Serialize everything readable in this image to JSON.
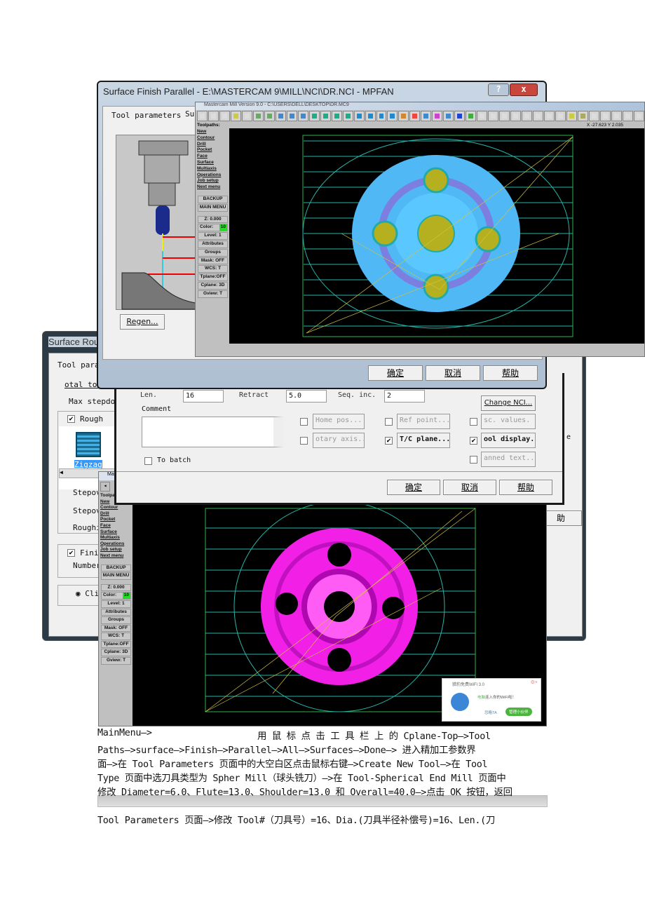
{
  "rough_window": {
    "title": "Surface Rou",
    "tab": "Tool param",
    "total_tol": "otal tol",
    "max_stepdown": "Max stepdow",
    "rough_label": "Rough",
    "zigzag": "Zigzag",
    "stepover1": "Stepov",
    "stepover2": "Stepov",
    "roughing": "Roughi",
    "finish_label": "Fini",
    "number": "Number",
    "climb": "Cli",
    "help_partial": "助",
    "side_e": "e"
  },
  "tool_dialog": {
    "len_label": "Len.",
    "len_value": "16",
    "retract_label": "Retract",
    "retract_value": "5.0",
    "seq_label": "Seq. inc.",
    "seq_value": "2",
    "comment_label": "Comment",
    "change_nci": "Change NCI...",
    "home_pos": "Home pos...",
    "ref_point": "Ref point...",
    "misc_values": "sc. values.",
    "rotary_axis": "otary axis..",
    "tc_plane": "T/C plane...",
    "tool_display": "ool display..",
    "canned_text": "anned text..",
    "to_batch": "To batch",
    "ok": "确定",
    "cancel": "取消",
    "help": "帮助",
    "checks": {
      "home_pos": false,
      "ref_point": false,
      "misc_values": false,
      "rotary_axis": false,
      "tc_plane": true,
      "tool_display": true,
      "canned_text": false,
      "to_batch": false
    }
  },
  "finish_dialog": {
    "title": "Surface Finish Parallel - E:\\MASTERCAM 9\\MILL\\NCI\\DR.NCI - MPFAN",
    "tab1": "Tool parameters",
    "tab2": "Su",
    "regen": "Regen...",
    "ok": "确定",
    "cancel": "取消",
    "help": "帮助",
    "help_icon": "?",
    "close_icon": "x"
  },
  "mastercam": {
    "title": "Mastercam Mill Version 9.0 - C:\\USERS\\DELL\\DESKTOP\\DR.MC9",
    "title_short": "Mas",
    "toolpaths": "Toolpaths:",
    "toolpaths_short": "Toolpa",
    "coords": "X -27.623  Y 2.035",
    "menu": [
      "New",
      "Contour",
      "Drill",
      "Pocket",
      "Face",
      "Surface",
      "Multiaxis",
      "Operations",
      "Job setup",
      "Next menu"
    ],
    "buttons": [
      "BACKUP",
      "MAIN MENU"
    ],
    "status": {
      "z": "Z:  0.000",
      "color_label": "Color:",
      "color_value": "10",
      "level": "Level:  1",
      "attributes": "Attributes",
      "groups": "Groups",
      "mask": "Mask:  OFF",
      "wcs": "WCS:  T",
      "tplane": "Tplane:OFF",
      "cplane": "Cplane: 3D",
      "gview": "Gview:  T"
    },
    "colors": {
      "disc_top": "#4fb8f5",
      "disc_bottom": "#f21fe6",
      "viewport": "#000000",
      "grid": "#27b5a8"
    }
  },
  "wifi_popup": {
    "title": "猎豹免费WiFi 3.0",
    "message_device": "电脑",
    "message": "连入你的WiFi啦！",
    "ignore": "忽略TA",
    "manage": "管理小伙伴"
  },
  "text": {
    "line1a": "MainMenu—>",
    "line1b": "用 鼠 标 点 击 工 具 栏 上 的  Cplane-Top—>Tool",
    "line2": "Paths—>surface—>Finish—>Parallel—>All—>Surfaces—>Done—> 进入精加工参数界",
    "line3": "面—>在 Tool Parameters 页面中的大空白区点击鼠标右键—>Create New Tool—>在 Tool",
    "line4": "Type 页面中选刀具类型为 Spher Mill（球头铣刀）—>在 Tool-Spherical End Mill 页面中",
    "line5": "修改 Diameter=6.0、Flute=13.0、Shoulder=13.0 和 Overall=40.0—>点击 OK 按钮，返回",
    "line6": "Tool Parameters 页面—>修改 Tool#（刀具号）=16、Dia.(刀具半径补偿号)=16、Len.(刀"
  }
}
